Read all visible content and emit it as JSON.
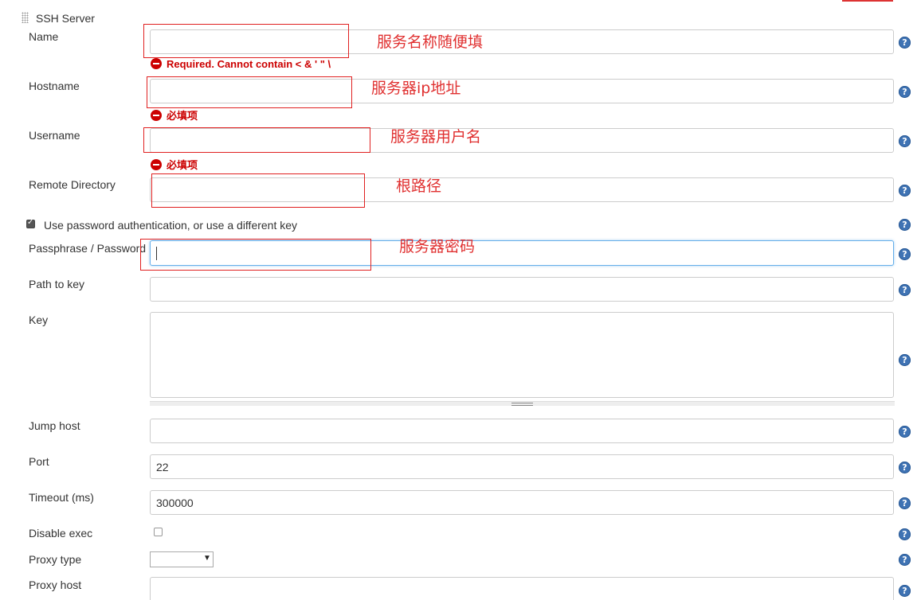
{
  "section": {
    "title": "SSH Server"
  },
  "fields": {
    "name": {
      "label": "Name",
      "value": "",
      "error": "Required. Cannot contain < & ' \" \\"
    },
    "hostname": {
      "label": "Hostname",
      "value": "",
      "error": "必填项"
    },
    "username": {
      "label": "Username",
      "value": "",
      "error": "必填项"
    },
    "remote_directory": {
      "label": "Remote Directory",
      "value": ""
    },
    "use_password": {
      "label": "Use password authentication, or use a different key",
      "checked": true
    },
    "passphrase": {
      "label": "Passphrase / Password",
      "value": ""
    },
    "path_to_key": {
      "label": "Path to key",
      "value": ""
    },
    "key": {
      "label": "Key",
      "value": ""
    },
    "jump_host": {
      "label": "Jump host",
      "value": ""
    },
    "port": {
      "label": "Port",
      "value": "22"
    },
    "timeout": {
      "label": "Timeout (ms)",
      "value": "300000"
    },
    "disable_exec": {
      "label": "Disable exec",
      "checked": false
    },
    "proxy_type": {
      "label": "Proxy type",
      "selected": ""
    },
    "proxy_host": {
      "label": "Proxy host",
      "value": ""
    }
  },
  "help_icon_symbol": "?",
  "annotations": {
    "name": "服务名称随便填",
    "hostname": "服务器ip地址",
    "username": "服务器用户名",
    "remote_directory": "根路径",
    "password": "服务器密码"
  },
  "colors": {
    "error": "#cc0000",
    "annotation": "#e03030",
    "help_icon": "#3f73b4",
    "focus_border": "#66afe9"
  }
}
